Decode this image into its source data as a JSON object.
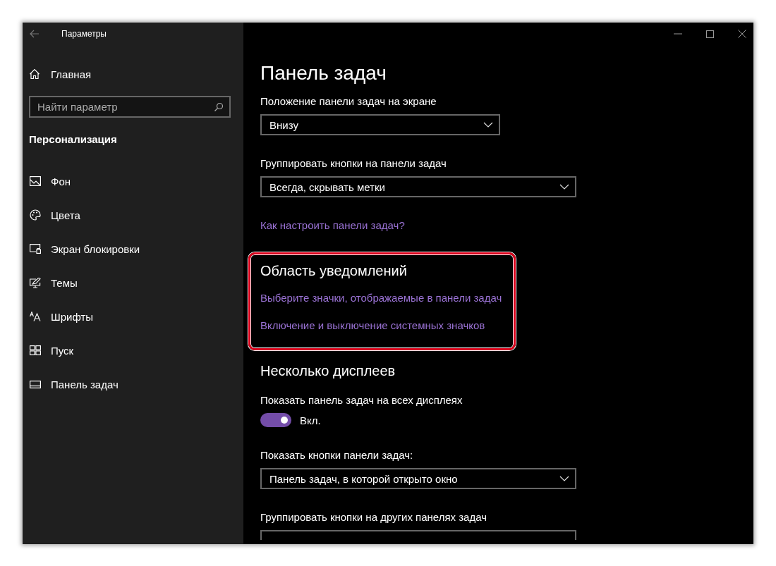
{
  "window": {
    "title": "Параметры"
  },
  "sidebar": {
    "home": "Главная",
    "search": {
      "placeholder": "Найти параметр"
    },
    "section": "Персонализация",
    "items": [
      {
        "label": "Фон"
      },
      {
        "label": "Цвета"
      },
      {
        "label": "Экран блокировки"
      },
      {
        "label": "Темы"
      },
      {
        "label": "Шрифты"
      },
      {
        "label": "Пуск"
      },
      {
        "label": "Панель задач"
      }
    ]
  },
  "main": {
    "title": "Панель задач",
    "items": [
      {
        "kind": "dropdown",
        "label": "Положение панели задач на экране",
        "value": "Внизу"
      },
      {
        "kind": "dropdown",
        "label": "Группировать кнопки на панели задач",
        "value": "Всегда, скрывать метки"
      },
      {
        "kind": "link",
        "label": "Как настроить панели задач?"
      }
    ],
    "notification_area": {
      "heading": "Область уведомлений",
      "links": [
        "Выберите значки, отображаемые в панели задач",
        "Включение и выключение системных значков"
      ]
    },
    "multiple_displays": {
      "heading": "Несколько дисплеев",
      "items": [
        {
          "kind": "toggle",
          "label": "Показать панель задач на всех дисплеях",
          "on": true,
          "state_text": "Вкл."
        },
        {
          "kind": "dropdown",
          "label": "Показать кнопки панели задач:",
          "value": "Панель задач, в которой открыто окно"
        },
        {
          "kind": "dropdown",
          "label": "Группировать кнопки на других панелях задач"
        }
      ]
    }
  }
}
